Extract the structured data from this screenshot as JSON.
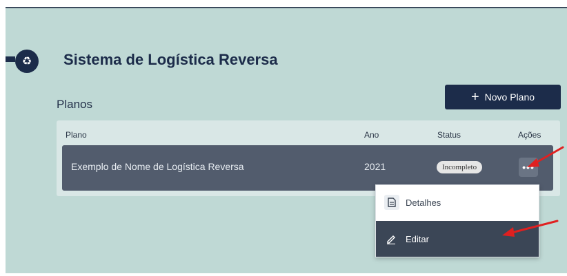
{
  "header": {
    "logo_icon": "recycle-icon",
    "title": "Sistema de Logística Reversa"
  },
  "section": {
    "title": "Planos"
  },
  "new_button": {
    "icon": "plus-icon",
    "label": "Novo Plano"
  },
  "table": {
    "columns": [
      "Plano",
      "Ano",
      "Status",
      "Ações"
    ],
    "rows": [
      {
        "plano": "Exemplo de Nome de Logística Reversa",
        "ano": "2021",
        "status": "Incompleto"
      }
    ]
  },
  "actions_menu": {
    "items": [
      {
        "icon": "document-icon",
        "label": "Detalhes"
      },
      {
        "icon": "pencil-icon",
        "label": "Editar"
      }
    ]
  },
  "colors": {
    "panel_bg": "#bfd9d5",
    "primary_dark": "#1c2c4a",
    "row_bg": "#525c6d",
    "menu_highlight": "#3b4656",
    "arrow": "#e02020"
  }
}
